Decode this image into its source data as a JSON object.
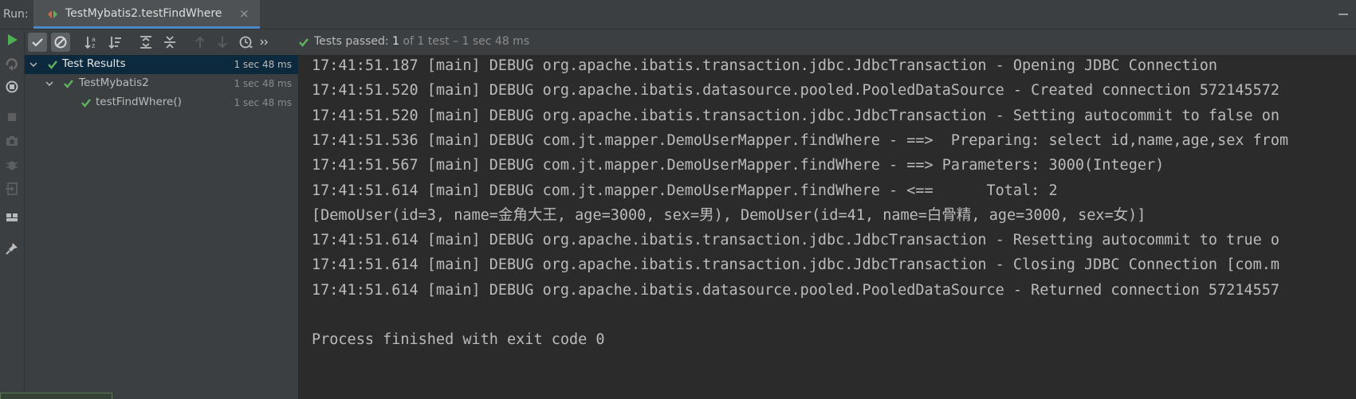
{
  "run_bar": {
    "label": "Run:",
    "tab_title": "TestMybatis2.testFindWhere",
    "close_glyph": "×"
  },
  "icons": {
    "left_toolbar": [
      "rerun-icon",
      "rerun-failed-icon",
      "toggle-auto-test-icon",
      "stop-icon",
      "camera-icon",
      "debug-icon",
      "exit-icon",
      "layout-icon",
      "pin-icon"
    ],
    "tree_toolbar": [
      "show-passed-icon",
      "show-ignored-icon",
      "sort-alpha-icon",
      "sort-duration-icon",
      "expand-all-icon",
      "collapse-all-icon",
      "previous-failed-icon",
      "next-failed-icon",
      "test-history-icon",
      "more-icon"
    ]
  },
  "colors": {
    "pass_green": "#5fb35f",
    "rerun_green": "#4caf50",
    "selection": "#0d293e",
    "accent_blue": "#4a88c7"
  },
  "status": {
    "passed_label": "Tests passed:",
    "count": "1",
    "detail": "of 1 test – 1 sec 48 ms"
  },
  "tree": [
    {
      "name": "Test Results",
      "time": "1 sec 48 ms",
      "level": 0,
      "expanded": true,
      "selected": true
    },
    {
      "name": "TestMybatis2",
      "time": "1 sec 48 ms",
      "level": 1,
      "expanded": true,
      "selected": false
    },
    {
      "name": "testFindWhere()",
      "time": "1 sec 48 ms",
      "level": 2,
      "expanded": false,
      "selected": false
    }
  ],
  "console_lines": [
    "17:41:51.187 [main] DEBUG org.apache.ibatis.transaction.jdbc.JdbcTransaction - Opening JDBC Connection",
    "17:41:51.520 [main] DEBUG org.apache.ibatis.datasource.pooled.PooledDataSource - Created connection 572145572",
    "17:41:51.520 [main] DEBUG org.apache.ibatis.transaction.jdbc.JdbcTransaction - Setting autocommit to false on",
    "17:41:51.536 [main] DEBUG com.jt.mapper.DemoUserMapper.findWhere - ==>  Preparing: select id,name,age,sex from",
    "17:41:51.567 [main] DEBUG com.jt.mapper.DemoUserMapper.findWhere - ==> Parameters: 3000(Integer)",
    "17:41:51.614 [main] DEBUG com.jt.mapper.DemoUserMapper.findWhere - <==      Total: 2",
    "[DemoUser(id=3, name=金角大王, age=3000, sex=男), DemoUser(id=41, name=白骨精, age=3000, sex=女)]",
    "17:41:51.614 [main] DEBUG org.apache.ibatis.transaction.jdbc.JdbcTransaction - Resetting autocommit to true o",
    "17:41:51.614 [main] DEBUG org.apache.ibatis.transaction.jdbc.JdbcTransaction - Closing JDBC Connection [com.m",
    "17:41:51.614 [main] DEBUG org.apache.ibatis.datasource.pooled.PooledDataSource - Returned connection 57214557",
    "",
    "Process finished with exit code 0"
  ]
}
